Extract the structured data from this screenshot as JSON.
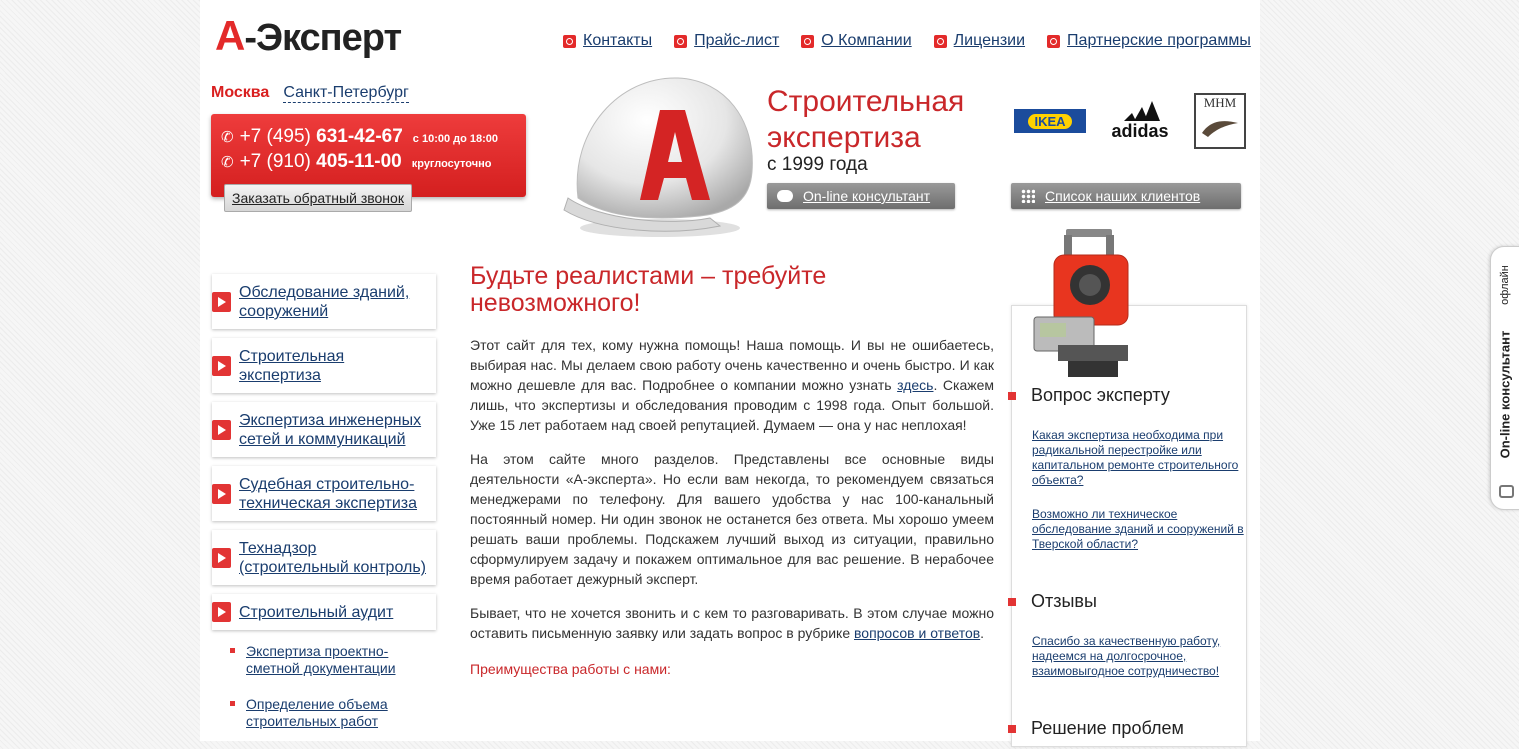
{
  "header": {
    "logo_letter": "А",
    "logo_rest": "-Эксперт",
    "nav": [
      "Контакты",
      "Прайс-лист",
      "О Компании",
      "Лицензии",
      "Партнерские программы"
    ],
    "cities": {
      "active": "Москва",
      "other": "Санкт-Петербург"
    },
    "phones": [
      {
        "prefix": "+7 (495) ",
        "number": "631-42-67",
        "note": "с 10:00 до 18:00"
      },
      {
        "prefix": "+7 (910) ",
        "number": "405-11-00",
        "note": "круглосуточно"
      }
    ],
    "callback_label": "Заказать обратный звонок",
    "title_line1": "Строительная",
    "title_line2": "экспертиза",
    "since": "с 1999 года",
    "consultant_button": "On-line консультант",
    "clients_button": "Список наших клиентов",
    "client_logos": [
      "IKEA",
      "adidas",
      "МНМ"
    ]
  },
  "sidebar": {
    "menu": [
      "Обследование зданий, сооружений",
      "Строительная экспертиза",
      "Экспертиза инженерных сетей и коммуникаций",
      "Судебная строительно-техническая экспертиза",
      "Технадзор (строительный контроль)",
      "Строительный аудит"
    ],
    "submenu": [
      "Экспертиза проектно-сметной документации",
      "Определение объема строительных работ"
    ]
  },
  "main": {
    "heading": "Будьте реалистами – требуйте невозможного!",
    "p1_before": "Этот сайт для тех, кому нужна помощь! Наша помощь. И вы не ошибаетесь, выбирая нас. Мы делаем свою работу очень качественно и очень быстро. И как можно дешевле для вас. Подробнее о компании можно узнать ",
    "p1_link": "здесь",
    "p1_after": ". Скажем лишь, что экспертизы и обследования проводим с 1998 года. Опыт большой. Уже 15 лет работаем над своей репутацией. Думаем — она у нас неплохая!",
    "p2": "На этом сайте много разделов. Представлены все основные виды деятельности «А-эксперта». Но если вам некогда, то рекомендуем связаться менеджерами по телефону. Для вашего удобства у нас 100-канальный постоянный номер. Ни один звонок не останется без ответа. Мы хорошо умеем решать ваши проблемы. Подскажем лучший выход из ситуации, правильно сформулируем задачу и покажем оптимальное для вас решение. В нерабочее время работает дежурный эксперт.",
    "p3_before": "Бывает, что не хочется звонить и с кем то разговаривать. В этом случае можно оставить письменную заявку или задать вопрос в рубрике ",
    "p3_link": "вопросов и ответов",
    "p3_after": ".",
    "advantages": "Преимущества работы с нами:"
  },
  "right": {
    "question_title": "Вопрос эксперту",
    "questions": [
      "Какая экспертиза необходима при радикальной перестройке или капитальном ремонте строительного объекта?",
      "Возможно ли техническое обследование зданий и сооружений в Тверской области?"
    ],
    "reviews_title": "Отзывы",
    "review": "Спасибо за качественную работу, надеемся на долгосрочное, взаимовыгодное сотрудничество!",
    "problems_title": "Решение проблем"
  },
  "widget": {
    "status": "офлайн",
    "label": "On-line консультант"
  },
  "colors": {
    "accent": "#e32a2a",
    "link": "#1a3d6e",
    "heading": "#c9272a"
  }
}
